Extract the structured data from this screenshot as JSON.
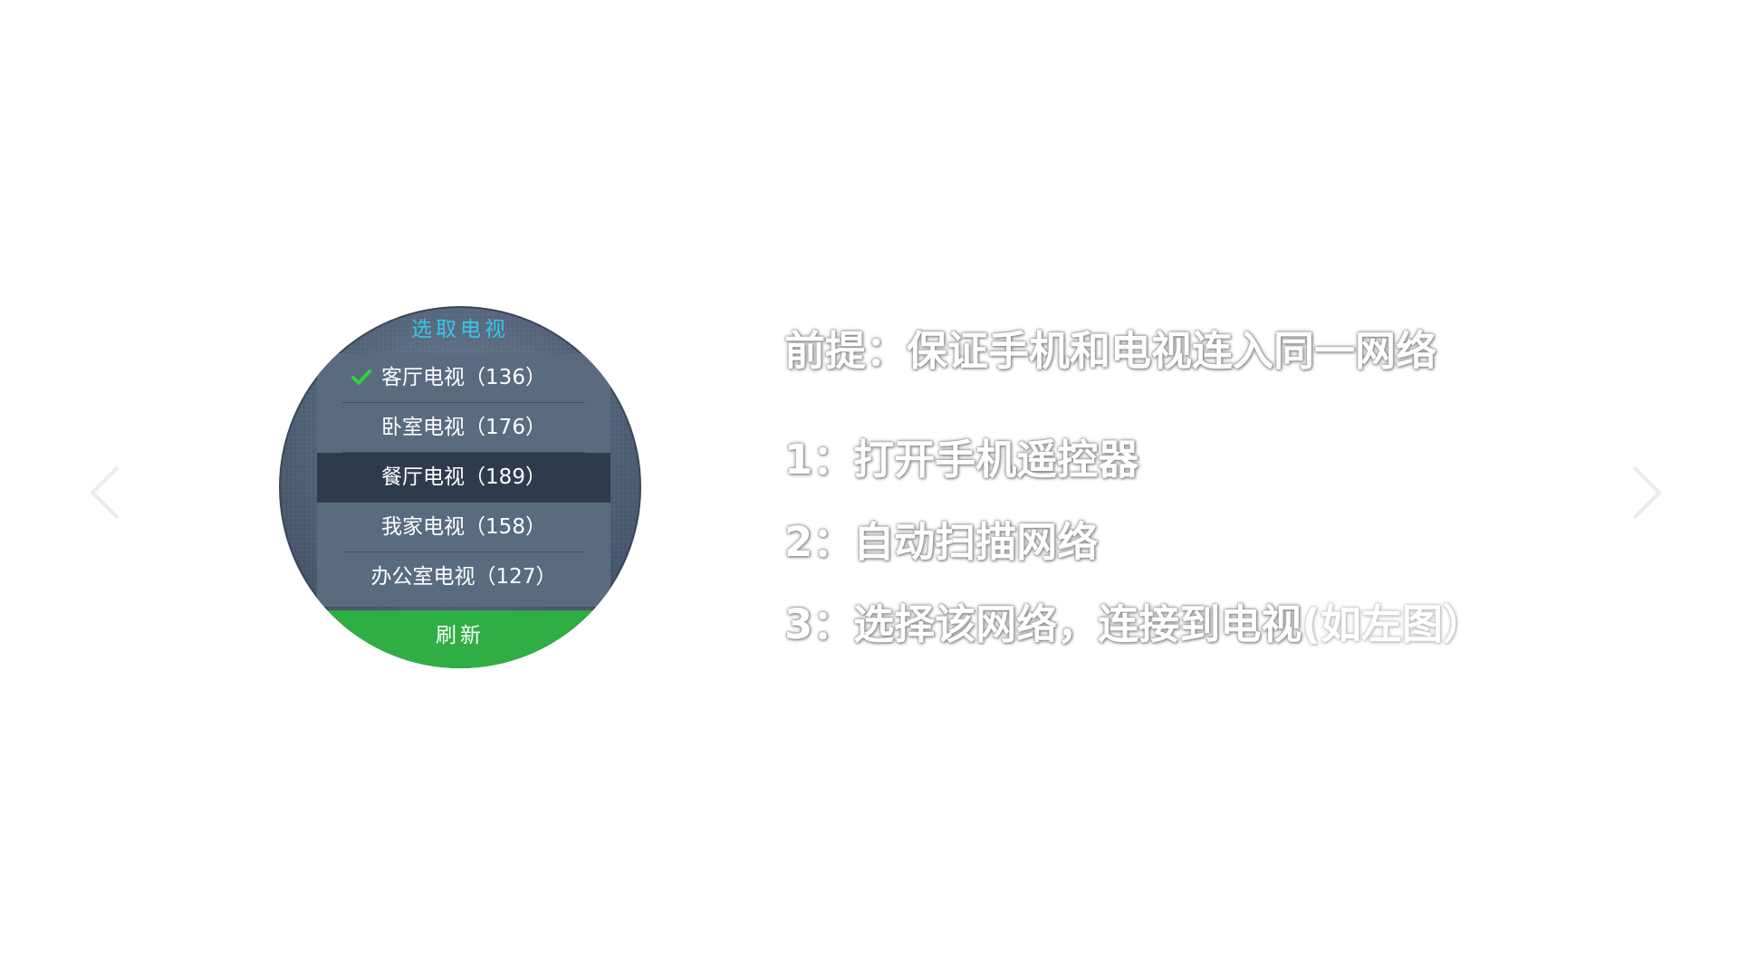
{
  "dialog": {
    "title": "选取电视",
    "tv_list": [
      {
        "label": "客厅电视（136）",
        "checked": true,
        "highlighted": false
      },
      {
        "label": "卧室电视（176）",
        "checked": false,
        "highlighted": false
      },
      {
        "label": "餐厅电视（189）",
        "checked": false,
        "highlighted": true
      },
      {
        "label": "我家电视（158）",
        "checked": false,
        "highlighted": false
      },
      {
        "label": "办公室电视（127）",
        "checked": false,
        "highlighted": false
      }
    ],
    "refresh_label": "刷新"
  },
  "instructions": {
    "premise": "前提：保证手机和电视连入同一网络",
    "step1": "1：打开手机遥控器",
    "step2": "2：自动扫描网络",
    "step3": "3：选择该网络，连接到电视",
    "step3_note": "(如左图）"
  },
  "navigation": {
    "prev_icon": "chevron-left-icon",
    "next_icon": "chevron-right-icon"
  },
  "colors": {
    "title_accent": "#38c4ea",
    "check_green": "#2fd13a",
    "refresh_green": "#2fae44",
    "highlight_row": "#2f3b4c",
    "list_bg": "#5a6b80"
  }
}
